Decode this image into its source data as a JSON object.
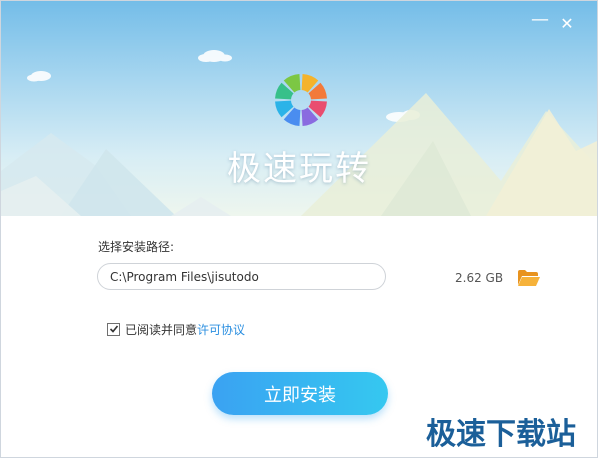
{
  "window": {
    "title": "极速玩转",
    "controls": {
      "minimize_glyph": "—",
      "close_glyph": "✕"
    }
  },
  "install": {
    "path_label": "选择安装路径:",
    "path_value": "C:\\Program Files\\jisutodo",
    "required_size": "2.62 GB",
    "browse_icon": "folder-open-icon",
    "agree_checked": true,
    "agree_text": "已阅读并同意",
    "license_link": "许可协议",
    "install_button": "立即安装"
  },
  "watermark": "极速下载站",
  "colors": {
    "accent": "#2b8fe0",
    "button_start": "#3aa2f2",
    "button_end": "#35c8f0",
    "folder": "#f4a52a",
    "watermark": "#1b5f99"
  },
  "logo_icon": "color-wheel-logo",
  "logo_colors": [
    "#f4b32c",
    "#f37a3a",
    "#e94d6f",
    "#8a6be0",
    "#4a8df0",
    "#2bb3e8",
    "#37c08a",
    "#7cc744"
  ]
}
